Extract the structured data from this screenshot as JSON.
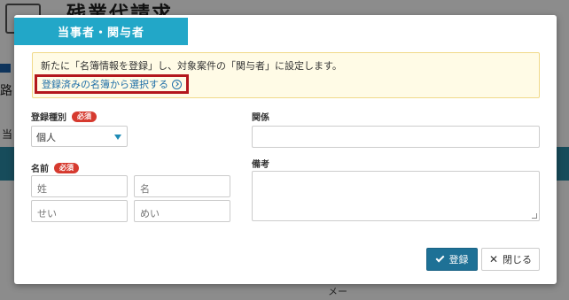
{
  "background": {
    "title": "残業代請求",
    "left_text_1": "路",
    "left_text_2": "当",
    "bottom_text": "メー"
  },
  "modal": {
    "tab_label": "当事者・関与者",
    "notice": {
      "text": "新たに「名簿情報を登録」し、対象案件の「関与者」に設定します。",
      "link_label": "登録済みの名簿から選択する"
    },
    "form": {
      "registration_type": {
        "label": "登録種別",
        "required_badge": "必須",
        "selected_value": "個人"
      },
      "name": {
        "label": "名前",
        "required_badge": "必須",
        "last_name_placeholder": "姓",
        "first_name_placeholder": "名",
        "last_kana_placeholder": "せい",
        "first_kana_placeholder": "めい"
      },
      "relationship": {
        "label": "関係",
        "value": ""
      },
      "remarks": {
        "label": "備考",
        "value": ""
      }
    },
    "buttons": {
      "register_label": "登録",
      "close_label": "閉じる"
    }
  },
  "colors": {
    "accent": "#22a7c8",
    "primary_button": "#1e7196",
    "required_badge": "#d63a2f",
    "highlight_border": "#b3171d",
    "link": "#1f6fa8"
  }
}
